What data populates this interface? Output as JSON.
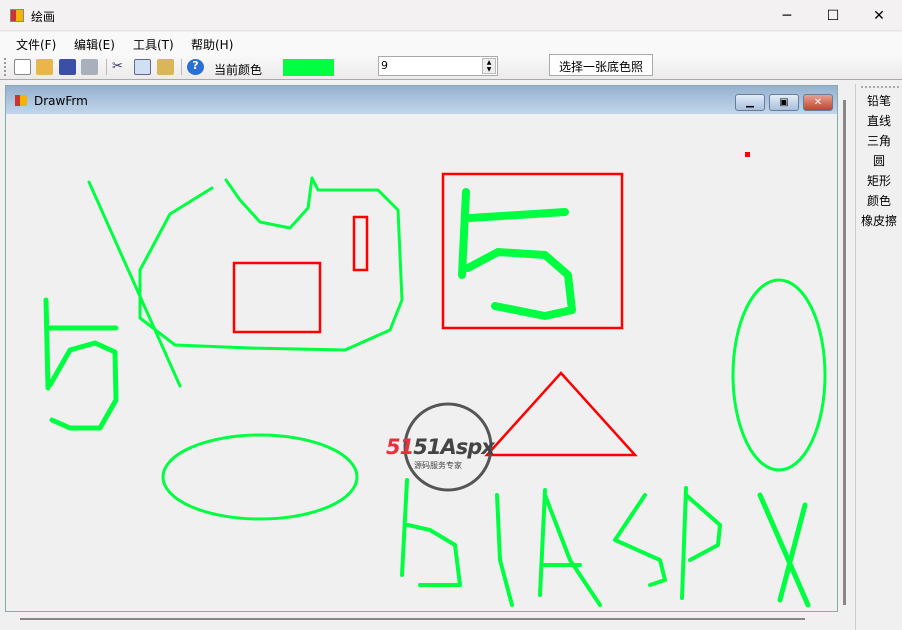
{
  "window": {
    "title": "绘画",
    "minimize": "─",
    "maximize": "☐",
    "close": "✕"
  },
  "menu": [
    "文件(F)",
    "编辑(E)",
    "工具(T)",
    "帮助(H)"
  ],
  "toolbar": {
    "icons": [
      "new-icon",
      "open-icon",
      "save-icon",
      "print-icon",
      "cut-icon",
      "copy-icon",
      "paste-icon",
      "help-icon"
    ],
    "current_color_label": "当前颜色",
    "current_color": "#00ff40",
    "size_value": "9",
    "choose_bg_label": "选择一张底色照"
  },
  "child": {
    "title": "DrawFrm"
  },
  "tools": [
    "铅笔",
    "直线",
    "三角",
    "圆",
    "矩形",
    "颜色",
    "橡皮擦"
  ],
  "watermark": {
    "brand": "51Aspx",
    "slogan": "源码服务专家"
  },
  "colors": {
    "green": "#00ff40",
    "red": "#ff0000"
  }
}
